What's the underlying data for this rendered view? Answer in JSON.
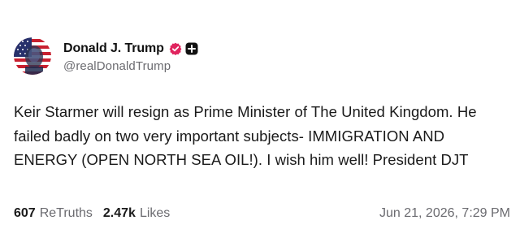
{
  "account": {
    "display_name": "Donald J. Trump",
    "handle": "@realDonaldTrump",
    "avatar_icon": "profile-photo-flag-icon",
    "verified_icon": "verified-check-badge-icon",
    "verified_color": "#e0245e",
    "plus_icon": "plus-square-icon"
  },
  "post": {
    "text": "Keir Starmer will resign as Prime Minister of The United Kingdom. He failed badly on two very important subjects- IMMIGRATION AND ENERGY (OPEN NORTH SEA OIL!). I wish him well! President DJT"
  },
  "stats": {
    "retruths_count": "607",
    "retruths_label": "ReTruths",
    "likes_count": "2.47k",
    "likes_label": "Likes"
  },
  "timestamp": "Jun 21, 2026, 7:29 PM",
  "colors": {
    "text_primary": "#1a1a1a",
    "text_secondary": "#6b6b70",
    "background": "#ffffff"
  }
}
